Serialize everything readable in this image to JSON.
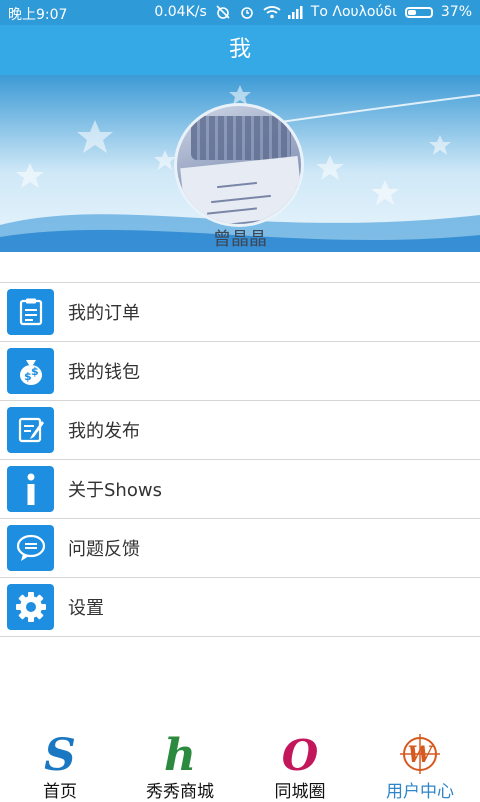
{
  "status_bar": {
    "time": "晚上9:07",
    "speed": "0.04K/s",
    "carrier": "Το Λουλούδι",
    "battery": "37%",
    "battery_level": 0.37,
    "icons": [
      "alarm-off-icon",
      "alarm-clock-icon",
      "wifi-icon",
      "signal-icon",
      "battery-icon"
    ]
  },
  "header": {
    "title": "我"
  },
  "profile": {
    "username": "曾晶晶"
  },
  "menu": {
    "items": [
      {
        "label": "我的订单",
        "icon": "order-clipboard-icon"
      },
      {
        "label": "我的钱包",
        "icon": "money-bag-icon"
      },
      {
        "label": "我的发布",
        "icon": "edit-note-icon"
      },
      {
        "label": "关于Shows",
        "icon": "info-icon"
      },
      {
        "label": "问题反馈",
        "icon": "chat-bubble-icon"
      },
      {
        "label": "设置",
        "icon": "gear-icon"
      }
    ]
  },
  "bottom_nav": {
    "items": [
      {
        "label": "首页",
        "glyph": "S",
        "active": false
      },
      {
        "label": "秀秀商城",
        "glyph": "h",
        "active": false
      },
      {
        "label": "同城圈",
        "glyph": "O",
        "active": false
      },
      {
        "label": "用户中心",
        "glyph": "W",
        "active": true
      }
    ]
  },
  "colors": {
    "accent": "#35a8e6",
    "status_bar": "#2f9ad8",
    "icon_bg": "#1e8fe0",
    "active_tab": "#2f86c8"
  }
}
